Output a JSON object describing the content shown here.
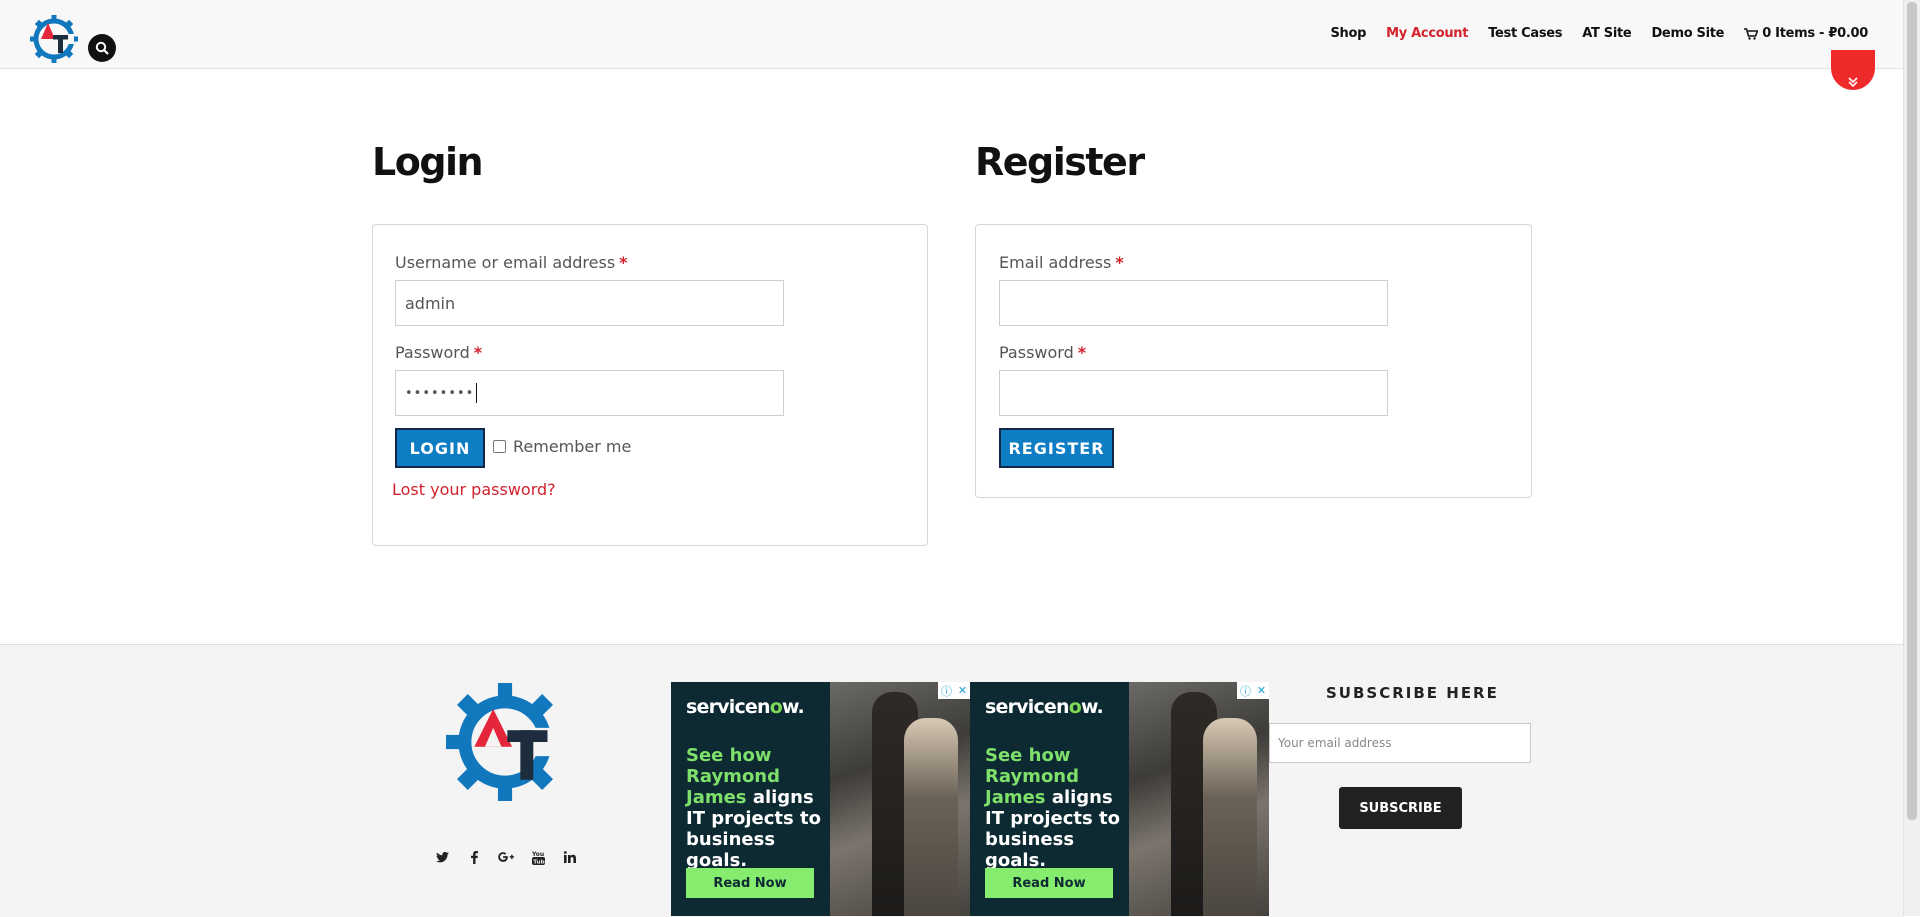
{
  "header": {
    "logo_alt": "AT",
    "nav": [
      {
        "label": "Shop"
      },
      {
        "label": "My Account",
        "active": true
      },
      {
        "label": "Test Cases"
      },
      {
        "label": "AT Site"
      },
      {
        "label": "Demo Site"
      }
    ],
    "cart_label": "0 Items - ₽0.00"
  },
  "login": {
    "title": "Login",
    "username_label": "Username or email address",
    "username_value": "admin",
    "password_label": "Password",
    "password_value": "••••••••",
    "required_mark": "*",
    "login_button": "LOGIN",
    "remember_label": "Remember me",
    "remember_checked": false,
    "lost_password": "Lost your password?"
  },
  "register": {
    "title": "Register",
    "email_label": "Email address",
    "email_value": "",
    "password_label": "Password",
    "password_value": "",
    "required_mark": "*",
    "register_button": "REGISTER"
  },
  "footer": {
    "social": [
      "twitter-icon",
      "facebook-icon",
      "google-plus-icon",
      "youtube-icon",
      "linkedin-icon"
    ],
    "ads": [
      {
        "brand_pre": "servicen",
        "brand_o": "o",
        "brand_post": "w.",
        "line_green": "See how Raymond James",
        "line_white": "aligns IT projects to business goals.",
        "cta": "Read Now"
      },
      {
        "brand_pre": "servicen",
        "brand_o": "o",
        "brand_post": "w.",
        "line_green": "See how Raymond James",
        "line_white": "aligns IT projects to business goals.",
        "cta": "Read Now"
      }
    ],
    "subscribe_title": "SUBSCRIBE HERE",
    "subscribe_placeholder": "Your email address",
    "subscribe_button": "SUBSCRIBE"
  },
  "colors": {
    "accent_red": "#d3222c",
    "button_blue": "#0f7dc3",
    "ad_green": "#86ec6e"
  }
}
